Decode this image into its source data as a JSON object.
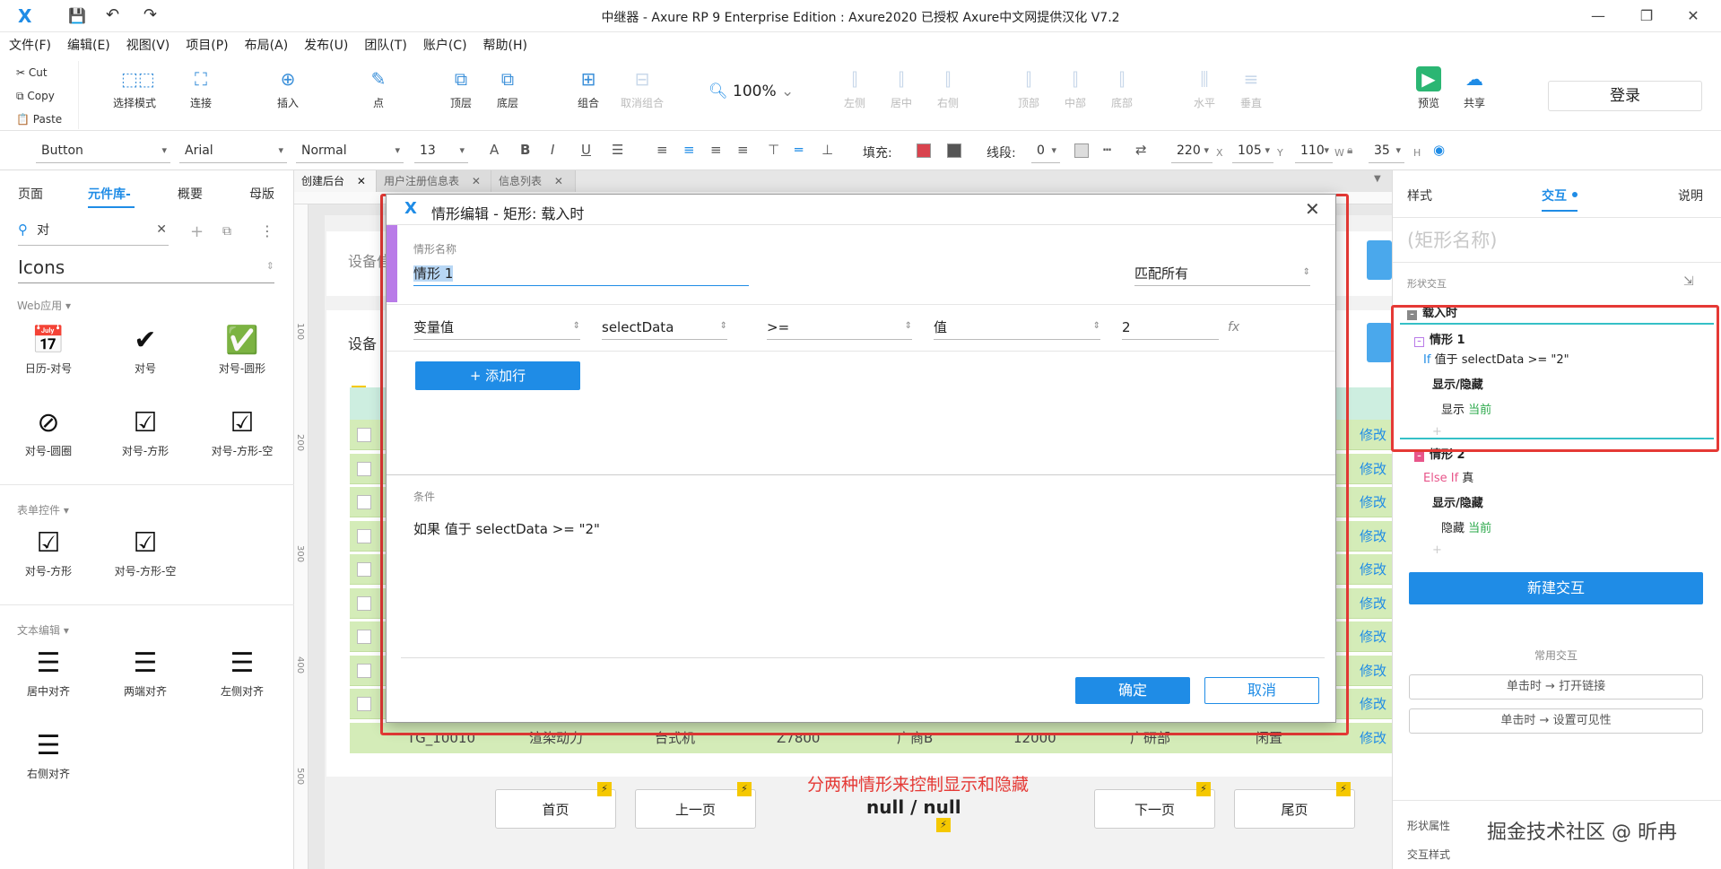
{
  "window": {
    "title": "中继器 - Axure RP 9 Enterprise Edition : Axure2020 已授权     Axure中文网提供汉化 V7.2",
    "minimize": "—",
    "maximize": "❐",
    "close": "✕"
  },
  "menu": [
    "文件(F)",
    "编辑(E)",
    "视图(V)",
    "项目(P)",
    "布局(A)",
    "发布(U)",
    "团队(T)",
    "账户(C)",
    "帮助(H)"
  ],
  "clipboard": {
    "cut": "Cut",
    "copy": "Copy",
    "paste": "Paste"
  },
  "toolbar": {
    "select_mode": "选择模式",
    "connect": "连接",
    "insert": "插入",
    "point": "点",
    "zoom": "100%",
    "top_layer": "顶层",
    "bottom_layer": "底层",
    "group": "组合",
    "ungroup": "取消组合",
    "align_left": "左侧",
    "align_center": "居中",
    "align_right": "右侧",
    "align_top": "顶部",
    "align_middle": "中部",
    "align_bottom": "底部",
    "dist_h": "水平",
    "dist_v": "垂直",
    "preview": "预览",
    "share": "共享",
    "login": "登录"
  },
  "format": {
    "widget_type": "Button",
    "font": "Arial",
    "style": "Normal",
    "size": "13",
    "fill_label": "填充:",
    "stroke_label": "线段:",
    "stroke_value": "0",
    "x": "220",
    "x_label": "X",
    "y": "105",
    "y_label": "Y",
    "w": "110",
    "w_label": "W",
    "h": "35",
    "h_label": "H"
  },
  "left_panel": {
    "tabs": [
      "页面",
      "元件库-",
      "概要",
      "母版"
    ],
    "search_value": "对",
    "library": "Icons",
    "sections": {
      "web": "Web应用 ▾",
      "form": "表单控件 ▾",
      "text": "文本编辑 ▾"
    },
    "web_items": [
      "日历-对号",
      "对号",
      "对号-圆形",
      "对号-圆圈",
      "对号-方形",
      "对号-方形-空"
    ],
    "form_items": [
      "对号-方形",
      "对号-方形-空"
    ],
    "text_items": [
      "居中对齐",
      "两端对齐",
      "左侧对齐",
      "右侧对齐"
    ]
  },
  "doc_tabs": [
    "创建后台",
    "用户注册信息表",
    "信息列表"
  ],
  "canvas": {
    "ruler_marks": [
      "100",
      "200",
      "300",
      "400",
      "500"
    ],
    "label_1": "设备信",
    "label_2": "设备",
    "row_action": "修改",
    "last_row": [
      "TG_10010",
      "渲染动力",
      "台式机",
      "Z7800",
      "广商B",
      "12000",
      "广研部",
      "闲置"
    ],
    "annotation": "分两种情形来控制显示和隐藏",
    "page_indicator": "null / null",
    "pager": {
      "first": "首页",
      "prev": "上一页",
      "next": "下一页",
      "last": "尾页"
    }
  },
  "dialog": {
    "title": "情形编辑  -  矩形: 载入时",
    "case_name_label": "情形名称",
    "case_name": "情形 1",
    "match": "匹配所有",
    "cond": {
      "type": "变量值",
      "var": "selectData",
      "op": ">=",
      "vtype": "值",
      "value": "2",
      "fx": "fx"
    },
    "add_row": "+ 添加行",
    "conditions_label": "条件",
    "condition_text": "如果 值于 selectData >= \"2\"",
    "ok": "确定",
    "cancel": "取消"
  },
  "right_panel": {
    "tabs": [
      "样式",
      "交互",
      "说明"
    ],
    "shape_name": "(矩形名称)",
    "shape_interactions": "形状交互",
    "event": "载入时",
    "case1": {
      "name": "情形 1",
      "cond_kw": "If",
      "cond": "值于 selectData >= \"2\"",
      "action": "显示/隐藏",
      "verb": "显示",
      "target": "当前"
    },
    "case2": {
      "name": "情形 2",
      "cond_kw": "Else If",
      "cond": "真",
      "action": "显示/隐藏",
      "verb": "隐藏",
      "target": "当前"
    },
    "plus": "+",
    "new_interaction": "新建交互",
    "common": "常用交互",
    "quick1": "单击时 → 打开链接",
    "quick2": "单击时 → 设置可见性",
    "shape_props": "形状属性",
    "interaction_style": "交互样式"
  },
  "watermark": "掘金技术社区 @ 昕冉"
}
